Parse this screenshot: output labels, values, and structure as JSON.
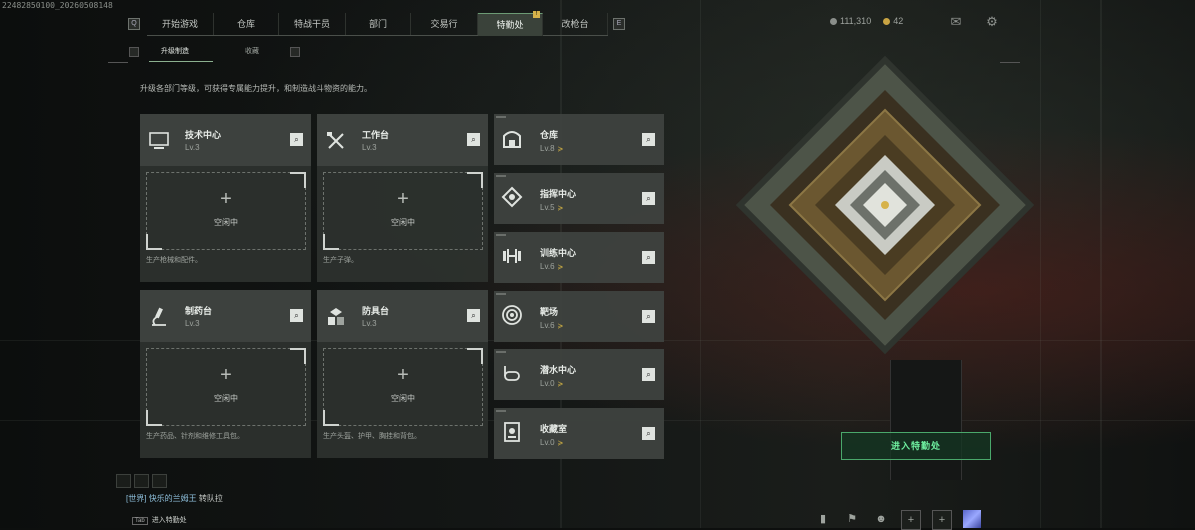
{
  "build_id": "22482850100_20260508148",
  "nav": {
    "tabs": [
      {
        "label": "开始游戏",
        "active": false
      },
      {
        "label": "仓库",
        "active": false
      },
      {
        "label": "特战干员",
        "active": false
      },
      {
        "label": "部门",
        "active": false
      },
      {
        "label": "交易行",
        "active": false
      },
      {
        "label": "特勤处",
        "active": true,
        "badge": "!"
      },
      {
        "label": "改枪台",
        "active": false
      }
    ],
    "left_key": "Q",
    "right_key": "E"
  },
  "currency": {
    "coins": "111,310",
    "gold": "42"
  },
  "subnav": {
    "tabs": [
      {
        "label": "升级制造",
        "active": true,
        "badge": "!"
      },
      {
        "label": "收藏",
        "active": false
      }
    ]
  },
  "description": "升级各部门等级，可获得专属能力提升，和制造战斗物资的能力。",
  "workshops": [
    {
      "name": "技术中心",
      "level": "Lv.3",
      "icon": "computer-icon",
      "slot_label": "空闲中",
      "desc": "生产枪械和配件。"
    },
    {
      "name": "工作台",
      "level": "Lv.3",
      "icon": "tools-icon",
      "slot_label": "空闲中",
      "desc": "生产子弹。"
    },
    {
      "name": "制药台",
      "level": "Lv.3",
      "icon": "microscope-icon",
      "slot_label": "空闲中",
      "desc": "生产药品、针剂和维修工具包。"
    },
    {
      "name": "防具台",
      "level": "Lv.3",
      "icon": "armor-icon",
      "slot_label": "空闲中",
      "desc": "生产头盔、护甲、胸挂和背包。"
    }
  ],
  "facilities": [
    {
      "name": "仓库",
      "level": "Lv.8",
      "icon": "warehouse-icon"
    },
    {
      "name": "指挥中心",
      "level": "Lv.5",
      "icon": "command-icon"
    },
    {
      "name": "训练中心",
      "level": "Lv.6",
      "icon": "dumbbell-icon"
    },
    {
      "name": "靶场",
      "level": "Lv.6",
      "icon": "target-icon"
    },
    {
      "name": "潜水中心",
      "level": "Lv.0",
      "icon": "diving-icon"
    },
    {
      "name": "收藏室",
      "level": "Lv.0",
      "icon": "collection-icon"
    }
  ],
  "enter_button": "进入特勤处",
  "chat": {
    "channel": "[世界]",
    "user": "快乐的兰姆王",
    "message": "转队拉"
  },
  "enter_bar": {
    "key": "Tab",
    "label": "进入特勤处"
  }
}
